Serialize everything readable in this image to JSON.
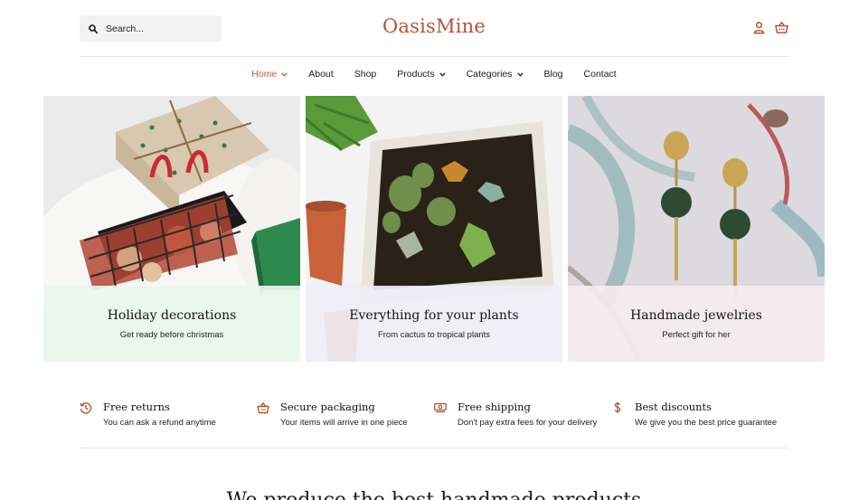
{
  "brand": {
    "name": "OasisMine",
    "color": "#b5532f"
  },
  "search": {
    "placeholder": "Search..."
  },
  "header_icons": [
    "user-icon",
    "basket-icon"
  ],
  "nav": [
    {
      "label": "Home",
      "active": true,
      "dropdown": true
    },
    {
      "label": "About",
      "active": false,
      "dropdown": false
    },
    {
      "label": "Shop",
      "active": false,
      "dropdown": false
    },
    {
      "label": "Products",
      "active": false,
      "dropdown": true
    },
    {
      "label": "Categories",
      "active": false,
      "dropdown": true
    },
    {
      "label": "Blog",
      "active": false,
      "dropdown": false
    },
    {
      "label": "Contact",
      "active": false,
      "dropdown": false
    }
  ],
  "collections": [
    {
      "title": "Holiday decorations",
      "subtitle": "Get ready before christmas"
    },
    {
      "title": "Everything for your plants",
      "subtitle": "From cactus to tropical plants"
    },
    {
      "title": "Handmade jewelries",
      "subtitle": "Perfect gift for her"
    }
  ],
  "features": [
    {
      "icon": "returns-clock-icon",
      "title": "Free returns",
      "text": "You can ask a refund anytime"
    },
    {
      "icon": "basket-icon",
      "title": "Secure packaging",
      "text": "Your items will arrive in one piece"
    },
    {
      "icon": "money-icon",
      "title": "Free shipping",
      "text": "Don't pay extra fees for your delivery"
    },
    {
      "icon": "dollar-icon",
      "title": "Best discounts",
      "text": "We give you the best price guarantee"
    }
  ],
  "section_heading": "We produce the best handmade products"
}
